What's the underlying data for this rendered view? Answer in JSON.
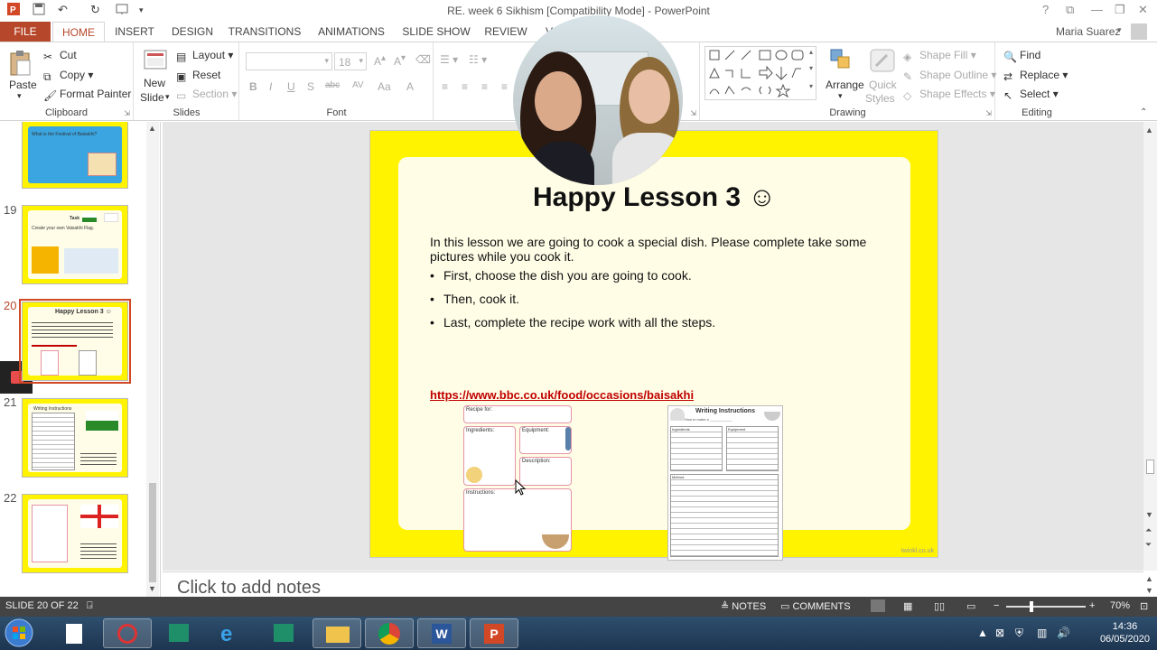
{
  "window": {
    "title": "RE. week 6 Sikhism [Compatibility Mode] - PowerPoint",
    "help": "?",
    "minimize": "—",
    "restore": "❐",
    "close": "✕",
    "ribbon_opts": "⧉"
  },
  "quick_access": {
    "undo": "↶",
    "redo": "↻"
  },
  "tabs": [
    {
      "label": "FILE"
    },
    {
      "label": "HOME"
    },
    {
      "label": "INSERT"
    },
    {
      "label": "DESIGN"
    },
    {
      "label": "TRANSITIONS"
    },
    {
      "label": "ANIMATIONS"
    },
    {
      "label": "SLIDE SHOW"
    },
    {
      "label": "REVIEW"
    },
    {
      "label": "V"
    }
  ],
  "user": {
    "name": "Maria Suarez"
  },
  "ribbon": {
    "clipboard": {
      "label": "Clipboard",
      "paste": "Paste",
      "cut": "Cut",
      "copy": "Copy",
      "format_painter": "Format Painter"
    },
    "slides": {
      "label": "Slides",
      "new_slide": "New",
      "new_slide_2": "Slide",
      "layout": "Layout",
      "reset": "Reset",
      "section": "Section"
    },
    "font": {
      "label": "Font",
      "size": "18",
      "bold": "B",
      "italic": "I",
      "underline": "U",
      "shadow": "S",
      "strike": "abc",
      "spacing": "AV",
      "case": "Aa",
      "color": "A"
    },
    "paragraph": {
      "label": ""
    },
    "drawing": {
      "label": "Drawing",
      "arrange": "Arrange",
      "quick_styles": "Quick",
      "quick_styles_2": "Styles",
      "shape_fill": "Shape Fill",
      "shape_outline": "Shape Outline",
      "shape_effects": "Shape Effects"
    },
    "editing": {
      "label": "Editing",
      "find": "Find",
      "replace": "Replace",
      "select": "Select"
    }
  },
  "thumbnails": [
    {
      "num": "",
      "text": "What is the Festival of Baisakhi?",
      "color": "#3aa5e0"
    },
    {
      "num": "19",
      "text": "Create your own Vaisakhi Flag.",
      "title": "Task"
    },
    {
      "num": "20",
      "title": "Happy Lesson 3 ☺",
      "selected": true
    },
    {
      "num": "21",
      "title": "Writing Instructions"
    },
    {
      "num": "22",
      "title": ""
    }
  ],
  "slide": {
    "title": "Happy Lesson 3 ☺",
    "intro": "In this lesson we are going to cook a special dish. Please complete take some pictures while you cook it.",
    "bullets": [
      "First, choose the dish you are going to cook.",
      "Then, cook it.",
      "Last, complete the recipe work with all the steps."
    ],
    "link": "https://www.bbc.co.uk/food/occasions/baisakhi",
    "watermark": "twinkl.co.uk",
    "recipe": {
      "recipe_for": "Recipe for:",
      "ingredients": "Ingredients:",
      "equipment": "Equipment:",
      "description": "Description:",
      "instructions": "Instructions:"
    },
    "writing": {
      "title": "Writing Instructions",
      "how_to": "How to make a ___________",
      "ingredients": "Ingredients",
      "equipment": "Equipment",
      "method": "Method"
    }
  },
  "notes": {
    "placeholder": "Click to add notes"
  },
  "status": {
    "slide_info": "SLIDE 20 OF 22",
    "notes": "NOTES",
    "comments": "COMMENTS",
    "zoom_minus": "−",
    "zoom_plus": "+",
    "zoom": "70%"
  },
  "taskbar": {
    "time": "14:36",
    "date": "06/05/2020"
  },
  "colors": {
    "accent": "#b7472a",
    "slide_bg": "#fff300",
    "link": "#c00000"
  }
}
